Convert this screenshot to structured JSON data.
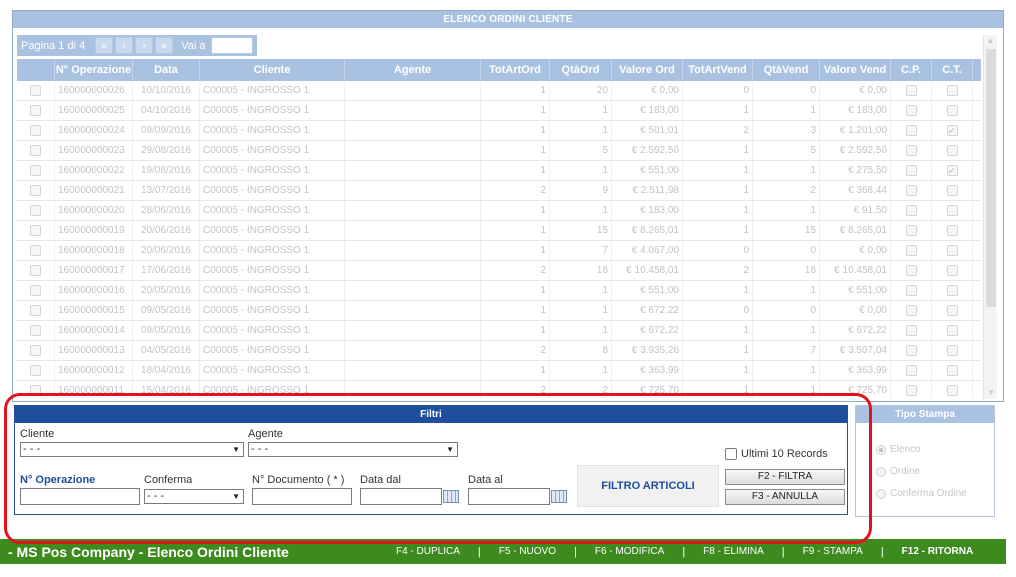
{
  "orders": {
    "title": "ELENCO ORDINI CLIENTE",
    "pager": {
      "page_label": "Pagina 1 di 4",
      "first": "«",
      "prev": "‹",
      "next": "›",
      "last": "»",
      "goto_label": "Vai a",
      "goto_value": ""
    },
    "columns": [
      "",
      "N° Operazione",
      "Data",
      "Cliente",
      "Agente",
      "TotArtOrd",
      "QtàOrd",
      "Valore Ord",
      "TotArtVend",
      "QtàVend",
      "Valore Vend",
      "C.P.",
      "C.T."
    ],
    "rows": [
      {
        "op": "160000000026",
        "data": "10/10/2016",
        "cliente": "C00005 - INGROSSO 1",
        "agente": "",
        "tao": "1",
        "qo": "20",
        "vo": "€ 0,00",
        "tav": "0",
        "qv": "0",
        "vv": "€ 0,00",
        "ct": false
      },
      {
        "op": "160000000025",
        "data": "04/10/2016",
        "cliente": "C00005 - INGROSSO 1",
        "agente": "",
        "tao": "1",
        "qo": "1",
        "vo": "€ 183,00",
        "tav": "1",
        "qv": "1",
        "vv": "€ 183,00",
        "ct": false
      },
      {
        "op": "160000000024",
        "data": "09/09/2016",
        "cliente": "C00005 - INGROSSO 1",
        "agente": "",
        "tao": "1",
        "qo": "1",
        "vo": "€ 501,01",
        "tav": "2",
        "qv": "3",
        "vv": "€ 1.201,00",
        "ct": true
      },
      {
        "op": "160000000023",
        "data": "29/08/2016",
        "cliente": "C00005 - INGROSSO 1",
        "agente": "",
        "tao": "1",
        "qo": "5",
        "vo": "€ 2.592,50",
        "tav": "1",
        "qv": "5",
        "vv": "€ 2.592,50",
        "ct": false
      },
      {
        "op": "160000000022",
        "data": "19/08/2016",
        "cliente": "C00005 - INGROSSO 1",
        "agente": "",
        "tao": "1",
        "qo": "1",
        "vo": "€ 551,00",
        "tav": "1",
        "qv": "1",
        "vv": "€ 275,50",
        "ct": true
      },
      {
        "op": "160000000021",
        "data": "13/07/2016",
        "cliente": "C00005 - INGROSSO 1",
        "agente": "",
        "tao": "2",
        "qo": "9",
        "vo": "€ 2.511,98",
        "tav": "1",
        "qv": "2",
        "vv": "€ 368,44",
        "ct": false
      },
      {
        "op": "160000000020",
        "data": "28/06/2016",
        "cliente": "C00005 - INGROSSO 1",
        "agente": "",
        "tao": "1",
        "qo": "1",
        "vo": "€ 183,00",
        "tav": "1",
        "qv": "1",
        "vv": "€ 91,50",
        "ct": false
      },
      {
        "op": "160000000019",
        "data": "20/06/2016",
        "cliente": "C00005 - INGROSSO 1",
        "agente": "",
        "tao": "1",
        "qo": "15",
        "vo": "€ 8.265,01",
        "tav": "1",
        "qv": "15",
        "vv": "€ 8.265,01",
        "ct": false
      },
      {
        "op": "160000000018",
        "data": "20/06/2016",
        "cliente": "C00005 - INGROSSO 1",
        "agente": "",
        "tao": "1",
        "qo": "7",
        "vo": "€ 4.067,00",
        "tav": "0",
        "qv": "0",
        "vv": "€ 0,00",
        "ct": false
      },
      {
        "op": "160000000017",
        "data": "17/06/2016",
        "cliente": "C00005 - INGROSSO 1",
        "agente": "",
        "tao": "2",
        "qo": "18",
        "vo": "€ 10.458,01",
        "tav": "2",
        "qv": "18",
        "vv": "€ 10.458,01",
        "ct": false
      },
      {
        "op": "160000000016",
        "data": "20/05/2016",
        "cliente": "C00005 - INGROSSO 1",
        "agente": "",
        "tao": "1",
        "qo": "1",
        "vo": "€ 551,00",
        "tav": "1",
        "qv": "1",
        "vv": "€ 551,00",
        "ct": false
      },
      {
        "op": "160000000015",
        "data": "09/05/2016",
        "cliente": "C00005 - INGROSSO 1",
        "agente": "",
        "tao": "1",
        "qo": "1",
        "vo": "€ 672,22",
        "tav": "0",
        "qv": "0",
        "vv": "€ 0,00",
        "ct": false
      },
      {
        "op": "160000000014",
        "data": "09/05/2016",
        "cliente": "C00005 - INGROSSO 1",
        "agente": "",
        "tao": "1",
        "qo": "1",
        "vo": "€ 672,22",
        "tav": "1",
        "qv": "1",
        "vv": "€ 672,22",
        "ct": false
      },
      {
        "op": "160000000013",
        "data": "04/05/2016",
        "cliente": "C00005 - INGROSSO 1",
        "agente": "",
        "tao": "2",
        "qo": "8",
        "vo": "€ 3.935,26",
        "tav": "1",
        "qv": "7",
        "vv": "€ 3.507,04",
        "ct": false
      },
      {
        "op": "160000000012",
        "data": "18/04/2016",
        "cliente": "C00005 - INGROSSO 1",
        "agente": "",
        "tao": "1",
        "qo": "1",
        "vo": "€ 363,99",
        "tav": "1",
        "qv": "1",
        "vv": "€ 363,99",
        "ct": false
      },
      {
        "op": "160000000011",
        "data": "15/04/2016",
        "cliente": "C00005 - INGROSSO 1",
        "agente": "",
        "tao": "2",
        "qo": "2",
        "vo": "€ 725,70",
        "tav": "1",
        "qv": "1",
        "vv": "€ 725,70",
        "ct": false
      }
    ]
  },
  "filtri": {
    "title": "Filtri",
    "cliente_label": "Cliente",
    "cliente_value": "- - -",
    "agente_label": "Agente",
    "agente_value": "- - -",
    "operazione_label": "N° Operazione",
    "conferma_label": "Conferma",
    "conferma_value": "- - -",
    "documento_label": "N° Documento ( * )",
    "data_dal_label": "Data dal",
    "data_al_label": "Data al",
    "filtro_articoli": "FILTRO ARTICOLI",
    "ultimi_label": "Ultimi 10 Records",
    "filtra_button": "F2 - FILTRA",
    "annulla_button": "F3 - ANNULLA"
  },
  "tipo_stampa": {
    "title": "Tipo Stampa",
    "options": [
      "Elenco",
      "Ordine",
      "Conferma Ordine"
    ]
  },
  "footer": {
    "title": "- MS Pos Company - Elenco Ordini Cliente",
    "keys": [
      "F4 - DUPLICA",
      "F5 - NUOVO",
      "F6 - MODIFICA",
      "F8 - ELIMINA",
      "F9 - STAMPA",
      "F12 - RITORNA"
    ]
  },
  "colors": {
    "header_blue": "#a9c2e2",
    "filtri_blue": "#1f4e9c",
    "footer_green": "#3d8a1e",
    "highlight_red": "#e3131b"
  }
}
